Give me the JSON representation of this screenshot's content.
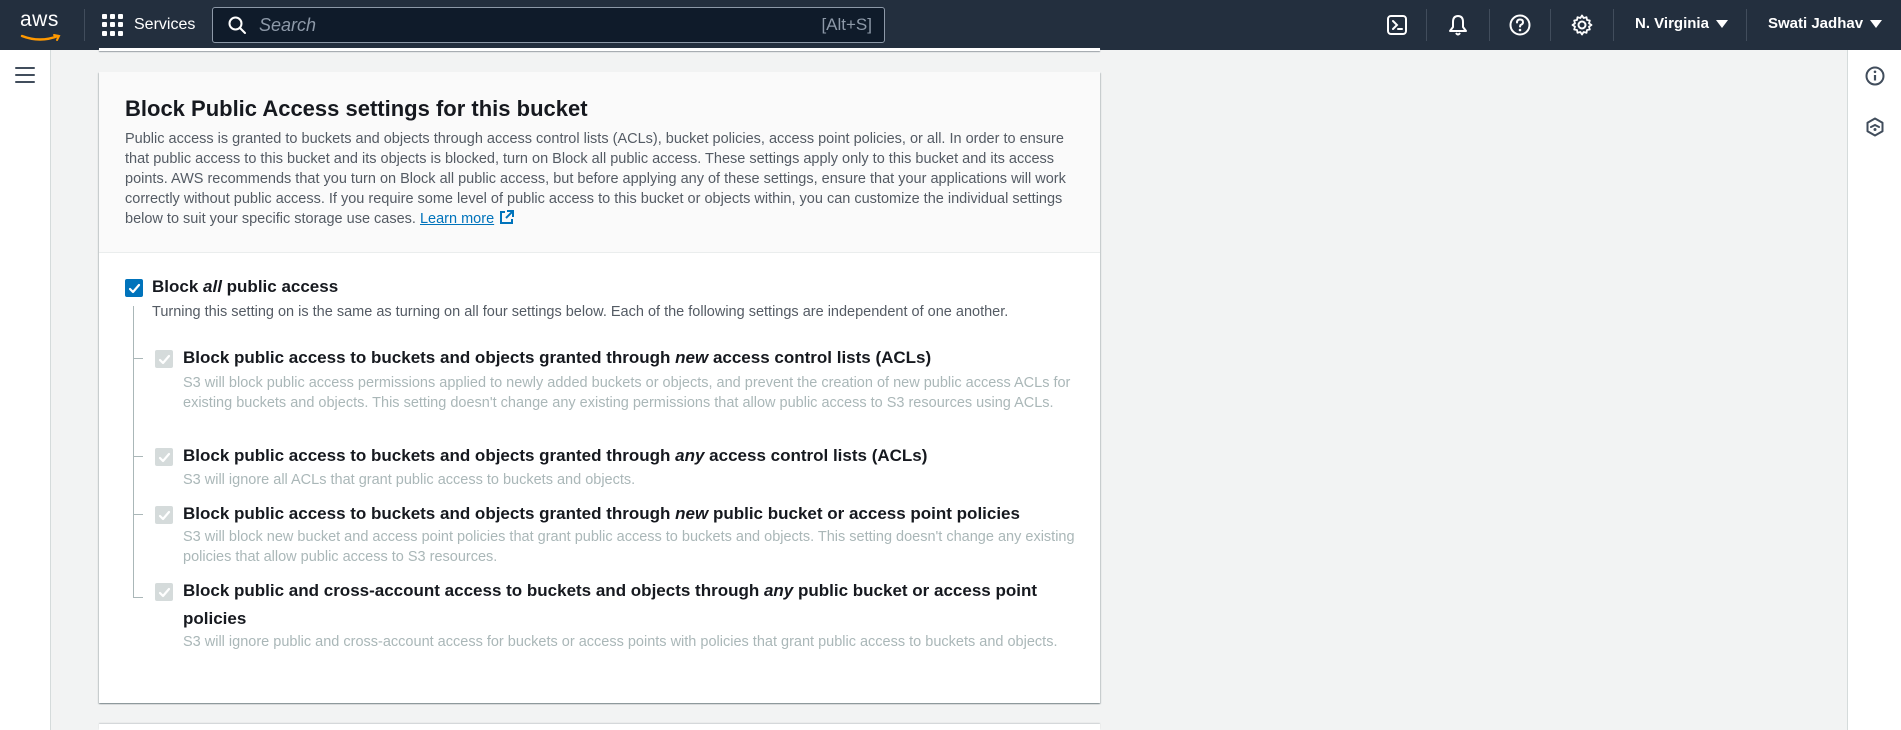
{
  "nav": {
    "logo_text": "aws",
    "services_label": "Services",
    "search_placeholder": "Search",
    "search_shortcut": "[Alt+S]",
    "region_label": "N. Virginia",
    "user_label": "Swati Jadhav",
    "icons": [
      "cloudshell-icon",
      "bell-icon",
      "help-icon",
      "gear-icon"
    ]
  },
  "rail": {
    "left_icons": [
      "menu-icon"
    ],
    "right_icons": [
      "info-icon",
      "feedback-icon"
    ]
  },
  "block_public_access": {
    "title": "Block Public Access settings for this bucket",
    "description": "Public access is granted to buckets and objects through access control lists (ACLs), bucket policies, access point policies, or all. In order to ensure that public access to this bucket and its objects is blocked, turn on Block all public access. These settings apply only to this bucket and its access points. AWS recommends that you turn on Block all public access, but before applying any of these settings, ensure that your applications will work correctly without public access. If you require some level of public access to this bucket or objects within, you can customize the individual settings below to suit your specific storage use cases.",
    "learn_more": "Learn more",
    "block_all": {
      "label_pre": "Block ",
      "label_em": "all",
      "label_post": " public access",
      "checked": true,
      "description": "Turning this setting on is the same as turning on all four settings below. Each of the following settings are independent of one another."
    },
    "options": [
      {
        "title_pre": "Block public access to buckets and objects granted through ",
        "title_em": "new",
        "title_post": " access control lists (ACLs)",
        "checked": true,
        "description": "S3 will block public access permissions applied to newly added buckets or objects, and prevent the creation of new public access ACLs for existing buckets and objects. This setting doesn't change any existing permissions that allow public access to S3 resources using ACLs."
      },
      {
        "title_pre": "Block public access to buckets and objects granted through ",
        "title_em": "any",
        "title_post": " access control lists (ACLs)",
        "checked": true,
        "description": "S3 will ignore all ACLs that grant public access to buckets and objects."
      },
      {
        "title_pre": "Block public access to buckets and objects granted through ",
        "title_em": "new",
        "title_post": " public bucket or access point policies",
        "checked": true,
        "description": "S3 will block new bucket and access point policies that grant public access to buckets and objects. This setting doesn't change any existing policies that allow public access to S3 resources."
      },
      {
        "title_pre": "Block public and cross-account access to buckets and objects through ",
        "title_em": "any",
        "title_post": " public bucket or access point policies",
        "checked": true,
        "description": "S3 will ignore public and cross-account access for buckets or access points with policies that grant public access to buckets and objects."
      }
    ]
  },
  "colors": {
    "nav_bg": "#232f3e",
    "accent": "#0073bb",
    "link": "#0073bb",
    "disabled_text": "#aab7b8"
  }
}
